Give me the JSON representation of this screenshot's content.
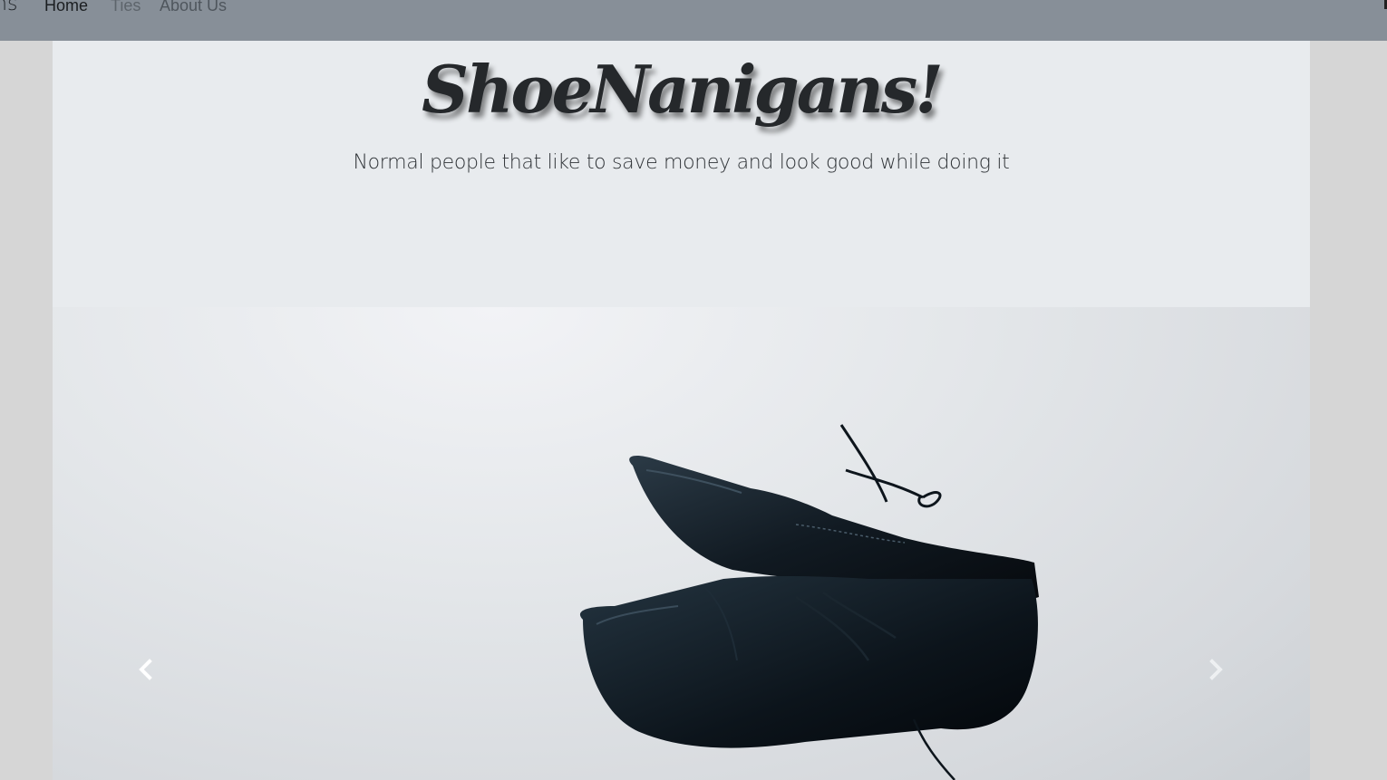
{
  "navbar": {
    "brand_partial": "ns",
    "links": [
      {
        "label": "Home",
        "active": true
      },
      {
        "label": "Ties",
        "active": false
      },
      {
        "label": "About Us",
        "active": false
      }
    ],
    "background_color": "#878f98"
  },
  "jumbotron": {
    "title": "ShoeNanigans!",
    "tagline": "Normal people that like to save money and look good while doing it",
    "background_color": "#e8ebee"
  },
  "carousel": {
    "slide_image": "black-dress-shoes-photo",
    "prev_icon": "chevron-left-icon",
    "next_icon": "chevron-right-icon"
  }
}
